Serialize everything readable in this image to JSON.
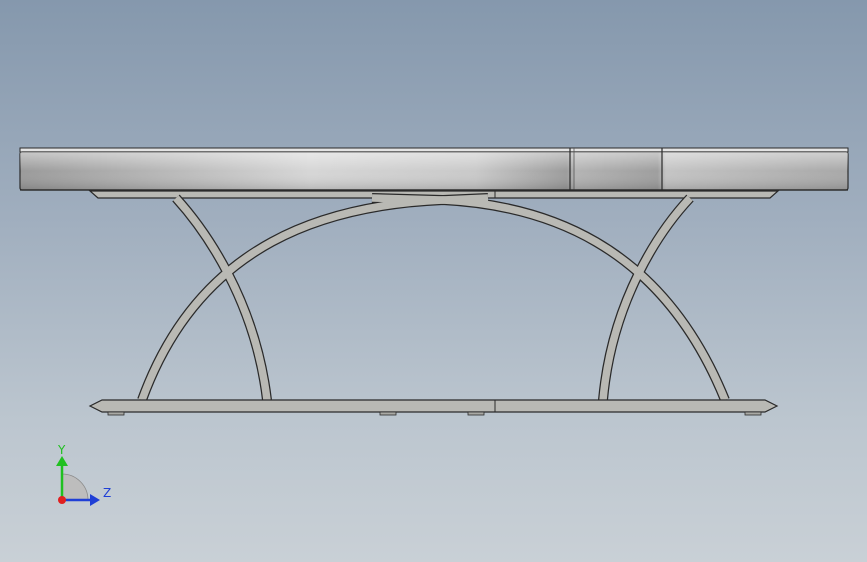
{
  "viewport": {
    "background_top": "#8598ad",
    "background_bottom": "#c9d0d6"
  },
  "model": {
    "part": "table",
    "view": "front",
    "top_color": "#c8c8c8",
    "frame_color": "#b9b9b4",
    "edge_color": "#2a2a2a"
  },
  "triad": {
    "y_label": "Y",
    "z_label": "Z",
    "y_color": "#20c020",
    "z_color": "#1f3fd6",
    "x_color": "#e02020"
  }
}
